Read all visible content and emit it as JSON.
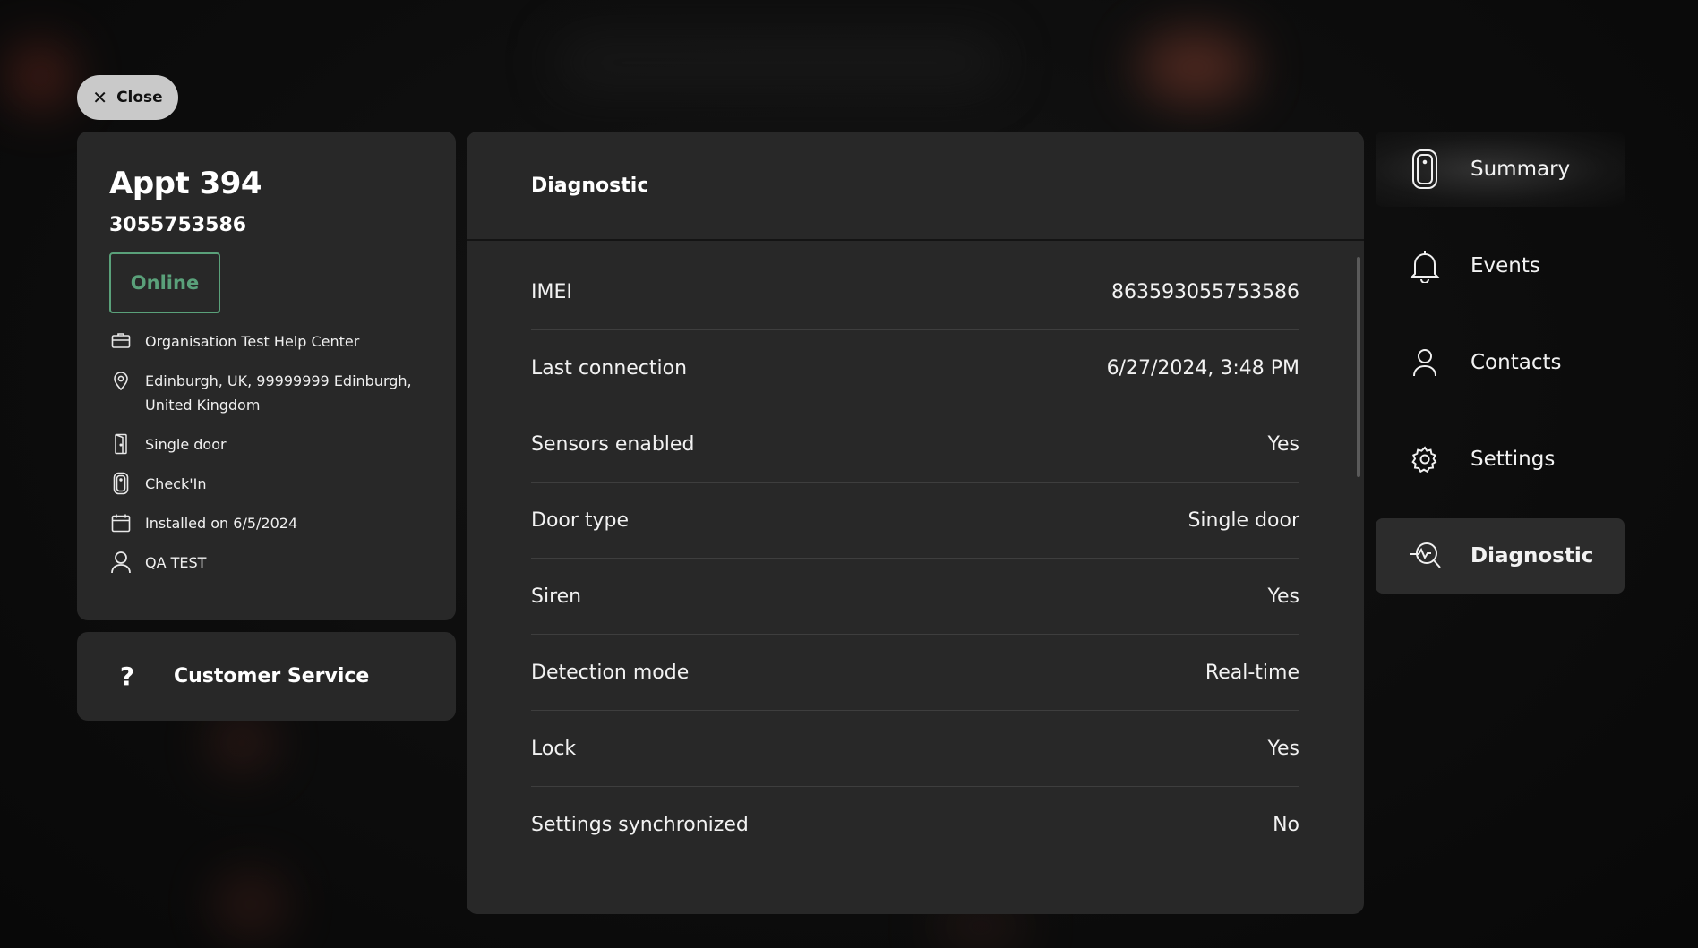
{
  "close_button": {
    "label": "Close",
    "icon": "close-icon"
  },
  "device": {
    "title": "Appt 394",
    "serial": "3055753586",
    "status": "Online",
    "status_color": "#5aa17a",
    "info": [
      {
        "icon": "organisation-icon",
        "text": "Organisation Test Help Center"
      },
      {
        "icon": "location-pin-icon",
        "text": "Edinburgh, UK, 99999999 Edinburgh, United Kingdom"
      },
      {
        "icon": "door-icon",
        "text": "Single door"
      },
      {
        "icon": "device-icon",
        "text": "Check'In"
      },
      {
        "icon": "calendar-icon",
        "text": "Installed on 6/5/2024"
      },
      {
        "icon": "person-icon",
        "text": "QA TEST"
      }
    ]
  },
  "customer_service": {
    "label": "Customer Service",
    "icon": "question-icon"
  },
  "diagnostic": {
    "title": "Diagnostic",
    "rows": [
      {
        "key": "IMEI",
        "value": "863593055753586"
      },
      {
        "key": "Last connection",
        "value": "6/27/2024, 3:48 PM"
      },
      {
        "key": "Sensors enabled",
        "value": "Yes"
      },
      {
        "key": "Door type",
        "value": "Single door"
      },
      {
        "key": "Siren",
        "value": "Yes"
      },
      {
        "key": "Detection mode",
        "value": "Real-time"
      },
      {
        "key": "Lock",
        "value": "Yes"
      },
      {
        "key": "Settings synchronized",
        "value": "No"
      }
    ]
  },
  "nav": {
    "items": [
      {
        "label": "Summary",
        "icon": "device-icon"
      },
      {
        "label": "Events",
        "icon": "bell-icon"
      },
      {
        "label": "Contacts",
        "icon": "person-icon"
      },
      {
        "label": "Settings",
        "icon": "gear-icon"
      },
      {
        "label": "Diagnostic",
        "icon": "diagnostic-icon"
      }
    ],
    "selected": "Diagnostic"
  }
}
